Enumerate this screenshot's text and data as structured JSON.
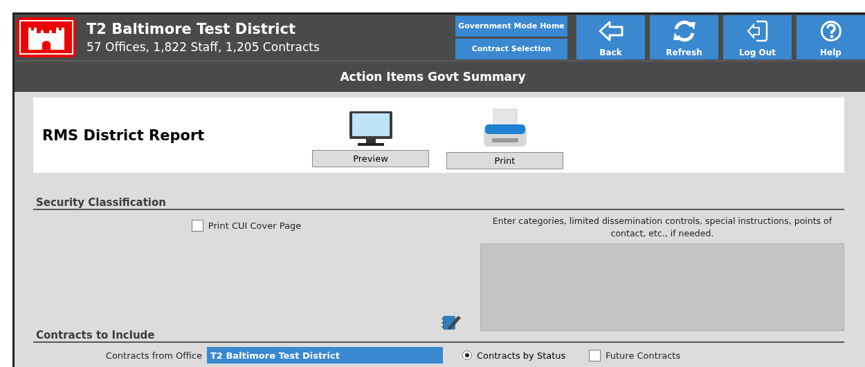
{
  "header": {
    "title": "T2 Baltimore Test District",
    "subtitle": "57 Offices, 1,822 Staff, 1,205 Contracts",
    "nav_links": [
      "Government Mode Home",
      "Contract Selection"
    ],
    "buttons": [
      {
        "kind": "back",
        "label": "Back"
      },
      {
        "kind": "refresh",
        "label": "Refresh"
      },
      {
        "kind": "logout",
        "label": "Log Out"
      },
      {
        "kind": "help",
        "label": "Help"
      }
    ]
  },
  "page_title": "Action Items Govt Summary",
  "report": {
    "title": "RMS District Report",
    "actions": [
      {
        "kind": "preview",
        "label": "Preview"
      },
      {
        "kind": "print",
        "label": "Print"
      }
    ]
  },
  "security": {
    "heading": "Security Classification",
    "cui_checkbox": {
      "label": "Print CUI Cover Page",
      "checked": false
    },
    "instructions": "Enter categories, limited dissemination controls, special instructions, points of contact, etc., if needed."
  },
  "contracts": {
    "heading": "Contracts to Include",
    "office_label": "Contracts from Office",
    "office_value": "T2 Baltimore Test District",
    "radio": {
      "label": "Contracts by Status",
      "selected": true
    },
    "checkbox": {
      "label": "Future Contracts",
      "checked": false
    }
  }
}
